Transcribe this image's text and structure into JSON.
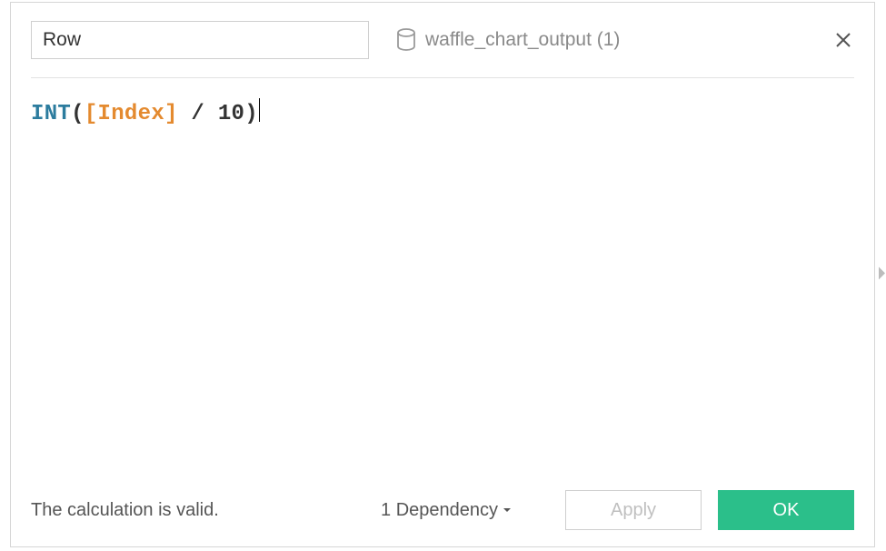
{
  "field_name": "Row",
  "datasource_label": "waffle_chart_output (1)",
  "formula": {
    "fn": "INT",
    "open": "(",
    "field": "[Index]",
    "op": " / ",
    "num": "10",
    "close": ")"
  },
  "status_text": "The calculation is valid.",
  "dependency_label": "1 Dependency",
  "buttons": {
    "apply": "Apply",
    "ok": "OK"
  }
}
